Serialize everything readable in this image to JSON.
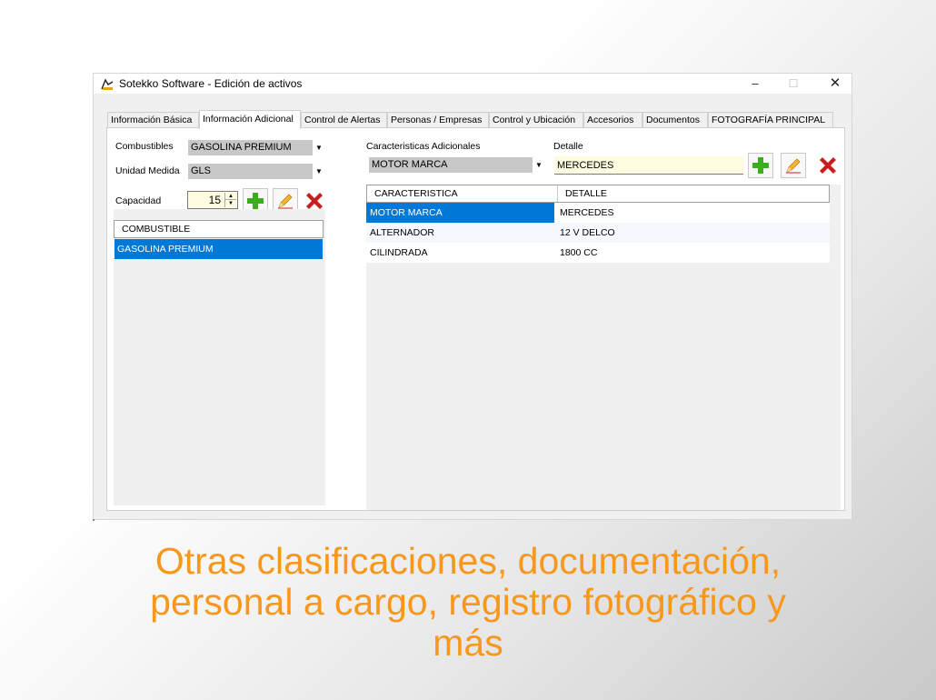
{
  "window": {
    "title": "Sotekko Software - Edición de activos",
    "controls": {
      "minimize": "–",
      "maximize": "☐",
      "close": "✕"
    }
  },
  "tabs": [
    {
      "label": "Información Básica",
      "active": false
    },
    {
      "label": "Información Adicional",
      "active": true
    },
    {
      "label": "Control de Alertas",
      "active": false
    },
    {
      "label": "Personas / Empresas",
      "active": false
    },
    {
      "label": "Control y Ubicación",
      "active": false
    },
    {
      "label": "Accesorios",
      "active": false
    },
    {
      "label": "Documentos",
      "active": false
    },
    {
      "label": "FOTOGRAFÍA PRINCIPAL",
      "active": false
    }
  ],
  "left": {
    "combustibles_label": "Combustibles",
    "combustibles_value": "GASOLINA PREMIUM",
    "unidad_label": "Unidad Medida",
    "unidad_value": "GLS",
    "capacidad_label": "Capacidad",
    "capacidad_value": "15",
    "grid": {
      "header": "COMBUSTIBLE",
      "rows": [
        "GASOLINA PREMIUM"
      ]
    }
  },
  "right": {
    "caracteristicas_label": "Caracteristicas Adicionales",
    "caracteristicas_value": "MOTOR MARCA",
    "detalle_label": "Detalle",
    "detalle_value": "MERCEDES",
    "grid": {
      "headers": [
        "CARACTERISTICA",
        "DETALLE"
      ],
      "rows": [
        [
          "MOTOR MARCA",
          "MERCEDES"
        ],
        [
          "ALTERNADOR",
          "12 V DELCO"
        ],
        [
          "CILINDRADA",
          "1800 CC"
        ]
      ]
    }
  },
  "icons": {
    "add": "plus-icon",
    "edit": "pencil-icon",
    "delete": "x-icon"
  },
  "colors": {
    "accent": "#0078d7",
    "caption": "#f7981d",
    "add_green": "#3cae1d",
    "delete_red": "#c81e1e"
  },
  "caption": {
    "line1": "Otras clasificaciones, documentación,",
    "line2": "personal a cargo, registro fotográfico y",
    "line3": "más"
  }
}
